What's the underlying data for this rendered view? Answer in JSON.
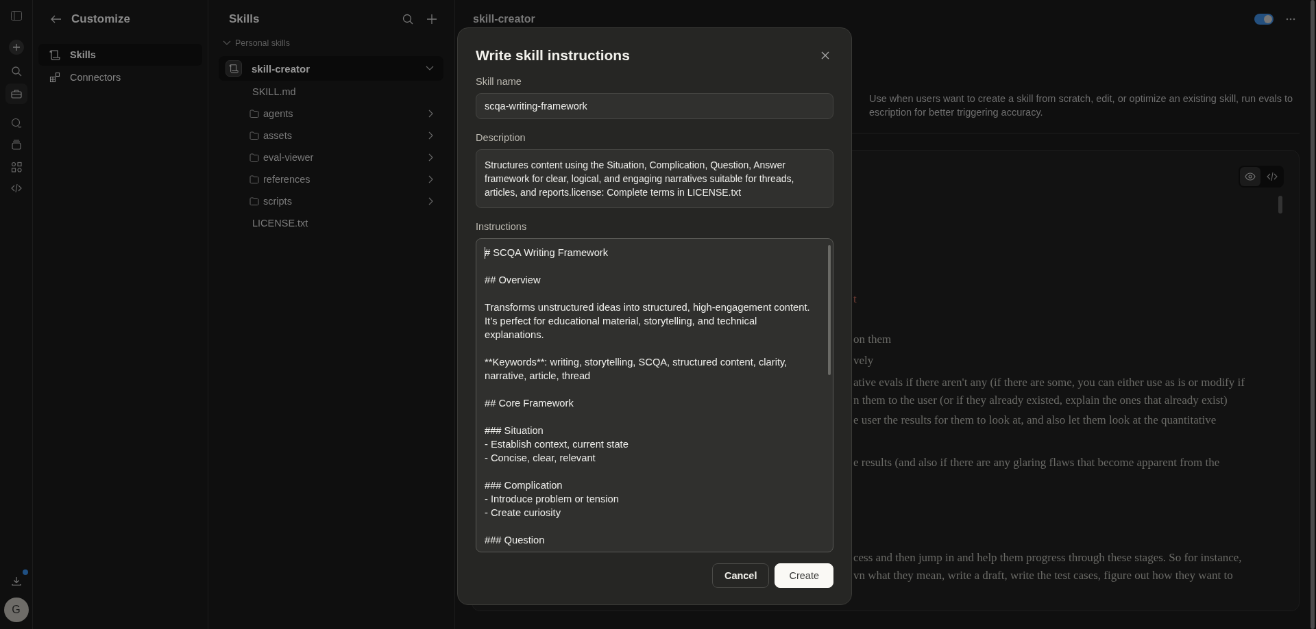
{
  "rail": {
    "avatar_initial": "G",
    "download_badge": true
  },
  "customize": {
    "title": "Customize",
    "items": [
      {
        "label": "Skills",
        "kind": "skills",
        "selected": true
      },
      {
        "label": "Connectors",
        "kind": "connectors",
        "selected": false
      }
    ]
  },
  "skills_panel": {
    "title": "Skills",
    "section": "Personal skills",
    "section_expanded": true,
    "skill": {
      "name": "skill-creator",
      "expanded": true,
      "children": [
        {
          "name": "SKILL.md",
          "kind": "file"
        },
        {
          "name": "agents",
          "kind": "folder"
        },
        {
          "name": "assets",
          "kind": "folder"
        },
        {
          "name": "eval-viewer",
          "kind": "folder"
        },
        {
          "name": "references",
          "kind": "folder"
        },
        {
          "name": "scripts",
          "kind": "folder"
        },
        {
          "name": "LICENSE.txt",
          "kind": "file"
        }
      ]
    }
  },
  "detail": {
    "title": "skill-creator",
    "enabled": true,
    "description_lines": [
      "Use when users want to create a skill from scratch, edit, or optimize an existing skill, run evals to",
      "escription for better triggering accuracy."
    ],
    "view_modes": [
      {
        "kind": "preview",
        "selected": true
      },
      {
        "kind": "code",
        "selected": false
      }
    ],
    "paragraphs": [
      {
        "kind": "link",
        "lines": [
          "t"
        ]
      },
      {
        "kind": "plain",
        "lines": [
          "on them"
        ]
      },
      {
        "kind": "plain",
        "lines": [
          "vely"
        ]
      },
      {
        "kind": "plain",
        "lines": [
          "ative evals if there aren't any (if there are some, you can either use as is or modify if",
          "n them to the user (or if they already existed, explain the ones that already exist)"
        ]
      },
      {
        "kind": "plain",
        "lines": [
          "e user the results for them to look at, and also let them look at the quantitative"
        ]
      },
      {
        "kind": "plain",
        "lines": [
          "e results (and also if there are any glaring flaws that become apparent from the"
        ]
      },
      {
        "kind": "plain",
        "lines": [
          "cess and then jump in and help them progress through these stages. So for instance,",
          "vn what they mean, write a draft, write the test cases, figure out how they want to"
        ]
      }
    ]
  },
  "dialog": {
    "title": "Write skill instructions",
    "skill_name": {
      "label": "Skill name",
      "value": "scqa-writing-framework"
    },
    "description": {
      "label": "Description",
      "value": "Structures content using the Situation, Complication, Question, Answer framework for clear, logical, and engaging narratives suitable for threads, articles, and reports.license: Complete terms in LICENSE.txt"
    },
    "instructions": {
      "label": "Instructions",
      "value": "# SCQA Writing Framework\n\n## Overview\n\nTransforms unstructured ideas into structured, high-engagement content. It’s perfect for educational material, storytelling, and technical explanations.\n\n**Keywords**: writing, storytelling, SCQA, structured content, clarity, narrative, article, thread\n\n## Core Framework\n\n### Situation\n- Establish context, current state\n- Concise, clear, relevant\n\n### Complication\n- Introduce problem or tension\n- Create curiosity\n\n### Question"
    },
    "buttons": [
      {
        "label": "Cancel",
        "kind": "secondary"
      },
      {
        "label": "Create",
        "kind": "primary"
      }
    ]
  }
}
